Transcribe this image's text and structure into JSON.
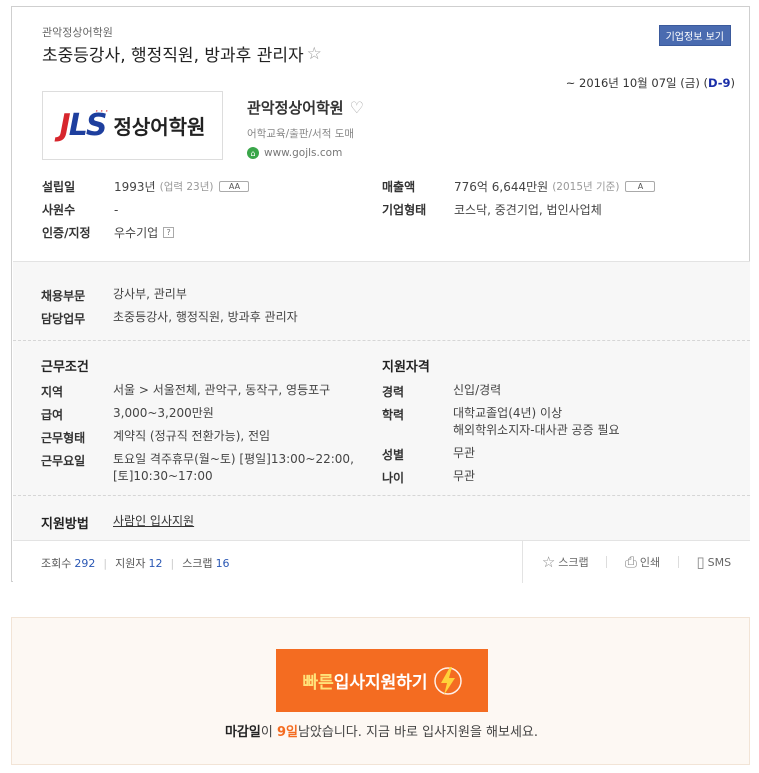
{
  "header": {
    "company_small": "관악정상어학원",
    "job_title": "초중등강사, 행정직원, 방과후 관리자",
    "corp_info_button": "기업정보 보기",
    "deadline_prefix": "~ 2016년 10월 07일 (금) (",
    "dday": "D-9",
    "deadline_suffix": ")"
  },
  "company": {
    "logo_letters": "JLS",
    "logo_name": "정상어학원",
    "name": "관악정상어학원",
    "industry": "어학교육/출판/서적 도매",
    "homepage": "www.gojls.com"
  },
  "info": {
    "founded_label": "설립일",
    "founded_value": "1993년",
    "founded_note": "(업력 23년)",
    "founded_badge": "AA",
    "employees_label": "사원수",
    "employees_value": "-",
    "cert_label": "인증/지정",
    "cert_value": "우수기업",
    "cert_help": "?",
    "revenue_label": "매출액",
    "revenue_value": "776억 6,644만원",
    "revenue_note": "(2015년 기준)",
    "revenue_badge": "A",
    "type_label": "기업형태",
    "type_value": "코스닥, 중견기업, 법인사업체"
  },
  "job": {
    "dept_label": "채용부문",
    "dept_value": "강사부, 관리부",
    "duty_label": "담당업무",
    "duty_value": "초중등강사, 행정직원, 방과후 관리자"
  },
  "conditions": {
    "title": "근무조건",
    "region_label": "지역",
    "region_value": "서울 > 서울전체, 관악구, 동작구, 영등포구",
    "pay_label": "급여",
    "pay_value": "3,000~3,200만원",
    "form_label": "근무형태",
    "form_value": "계약직 (정규직 전환가능), 전임",
    "days_label": "근무요일",
    "days_value_1": "토요일 격주휴무(월~토) [평일]13:00~22:00,",
    "days_value_2": "[토]10:30~17:00"
  },
  "qualification": {
    "title": "지원자격",
    "career_label": "경력",
    "career_value": "신입/경력",
    "edu_label": "학력",
    "edu_value_1": "대학교졸업(4년) 이상",
    "edu_value_2": "해외학위소지자-대사관 공증 필요",
    "gender_label": "성별",
    "gender_value": "무관",
    "age_label": "나이",
    "age_value": "무관"
  },
  "apply_method": {
    "label": "지원방법",
    "value": "사람인 입사지원"
  },
  "stats": {
    "views_label": "조회수",
    "views": "292",
    "applicants_label": "지원자",
    "applicants": "12",
    "scraps_label": "스크랩",
    "scraps": "16"
  },
  "actions": {
    "scrap": "스크랩",
    "print": "인쇄",
    "sms": "SMS"
  },
  "apply": {
    "btn_highlight": "빠른",
    "btn_rest": "입사지원하기",
    "remain_strong": "마감일",
    "remain_mid": "이 ",
    "remain_days": "9일",
    "remain_rest": "남았습니다. 지금 바로 입사지원을 해보세요."
  }
}
